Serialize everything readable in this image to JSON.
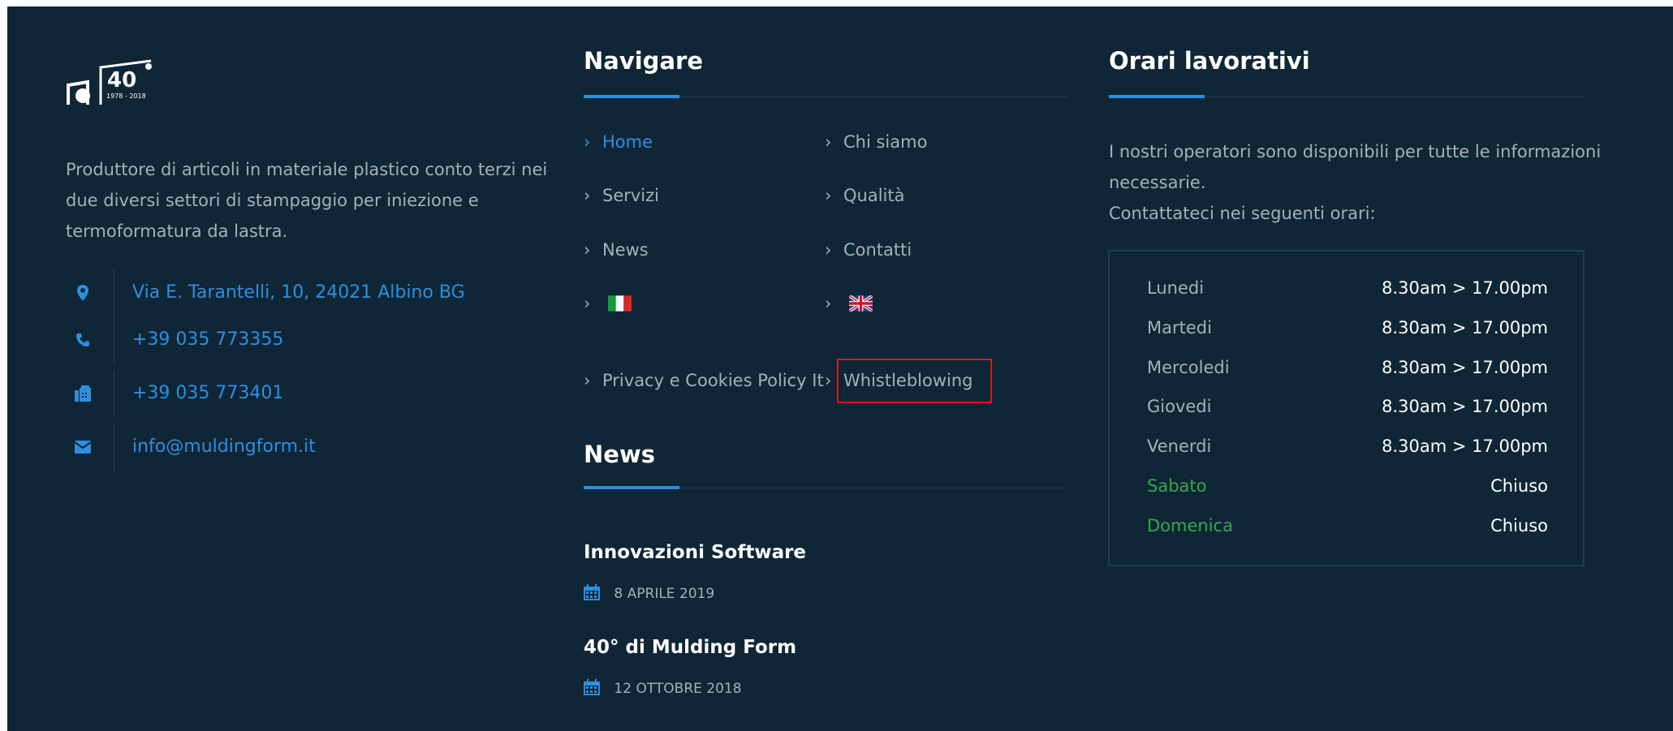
{
  "logo": {
    "alt_text": "40",
    "years_text": "1978 - 2018"
  },
  "about": {
    "description": "Produttore di articoli in materiale plastico conto terzi nei due diversi settori di stampaggio per iniezione e termoformatura da lastra."
  },
  "contacts": [
    {
      "icon": "map-marker-icon",
      "text": "Via E. Tarantelli, 10, 24021 Albino BG"
    },
    {
      "icon": "phone-icon",
      "text": "+39 035 773355"
    },
    {
      "icon": "fax-icon",
      "text": "+39 035 773401"
    },
    {
      "icon": "envelope-icon",
      "text": "info@muldingform.it"
    }
  ],
  "nav": {
    "heading": "Navigare",
    "links": [
      {
        "label": "Home",
        "active": true
      },
      {
        "label": "Chi siamo"
      },
      {
        "label": "Servizi"
      },
      {
        "label": "Qualità"
      },
      {
        "label": "News"
      },
      {
        "label": "Contatti"
      },
      {
        "label": "",
        "icon": "flag-italy-icon"
      },
      {
        "label": "",
        "icon": "flag-uk-icon"
      },
      {
        "label": "Privacy e Cookies Policy It"
      },
      {
        "label": "Whistleblowing",
        "highlighted": true
      }
    ]
  },
  "news": {
    "heading": "News",
    "items": [
      {
        "title": "Innovazioni Software",
        "date": "8 APRILE 2019"
      },
      {
        "title": "40° di Mulding Form",
        "date": "12 OTTOBRE 2018"
      }
    ]
  },
  "hours": {
    "heading": "Orari lavorativi",
    "intro_line1": "I nostri operatori sono disponibili per tutte le informazioni necessarie.",
    "intro_line2": "Contattateci nei seguenti orari:",
    "rows": [
      {
        "day": "Lunedi",
        "time": "8.30am > 17.00pm"
      },
      {
        "day": "Martedi",
        "time": "8.30am > 17.00pm"
      },
      {
        "day": "Mercoledi",
        "time": "8.30am > 17.00pm"
      },
      {
        "day": "Giovedi",
        "time": "8.30am > 17.00pm"
      },
      {
        "day": "Venerdi",
        "time": "8.30am > 17.00pm"
      },
      {
        "day": "Sabato",
        "time": "Chiuso",
        "closed": true
      },
      {
        "day": "Domenica",
        "time": "Chiuso",
        "closed": true
      }
    ]
  },
  "colors": {
    "background": "#0f2636",
    "accent": "#2d8fe0",
    "text": "#a3b1bb",
    "closed_day": "#34a84e",
    "highlight_border": "#e0141e"
  }
}
